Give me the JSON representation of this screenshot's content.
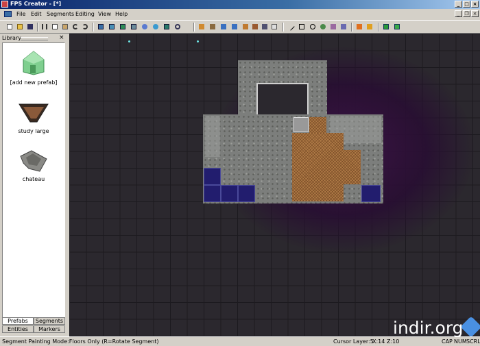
{
  "window": {
    "title": "FPS Creator - [*]",
    "buttons": {
      "minimize": "_",
      "maximize": "□",
      "close": "×"
    }
  },
  "menubar": {
    "items": [
      "File",
      "Edit",
      "Segments",
      "Editing",
      "View",
      "Help"
    ],
    "mdi_buttons": {
      "minimize": "_",
      "restore": "❐",
      "close": "×"
    }
  },
  "toolbar": {
    "icons": [
      "new-icon",
      "open-icon",
      "save-icon",
      "cut-icon",
      "copy-icon",
      "paste-icon",
      "undo-icon",
      "redo-icon",
      "view-icon-1",
      "view-icon-2",
      "view-icon-3",
      "view-icon-4",
      "view-icon-5",
      "view-icon-6",
      "view-icon-7",
      "zoom-icon",
      "paint-icon-1",
      "paint-icon-2",
      "paint-icon-3",
      "paint-icon-4",
      "paint-icon-5",
      "paint-icon-6",
      "paint-icon-7",
      "paint-icon-8",
      "line-icon",
      "rect-icon",
      "circle-icon",
      "entity-icon-1",
      "entity-icon-2",
      "entity-icon-3",
      "flag-icon-1",
      "flag-icon-2",
      "test-game-icon",
      "build-game-icon"
    ]
  },
  "library": {
    "title": "Library",
    "close": "×",
    "prefabs": [
      {
        "label": "[add new prefab]",
        "icon": "house-icon"
      },
      {
        "label": "study large",
        "icon": "room-icon"
      },
      {
        "label": "chateau",
        "icon": "building-icon"
      }
    ],
    "tabs_top": [
      "Prefabs",
      "Segments"
    ],
    "tabs_bottom": [
      "Entities",
      "Markers"
    ]
  },
  "statusbar": {
    "mode": "Segment Painting Mode:Floors Only (R=Rotate Segment)",
    "cursor_layer": "Cursor Layer:5",
    "x": "X:14",
    "z": "Z:10",
    "cap": "CAP",
    "num": "NUM",
    "scrl": "SCRL"
  },
  "watermark": "indir.org"
}
